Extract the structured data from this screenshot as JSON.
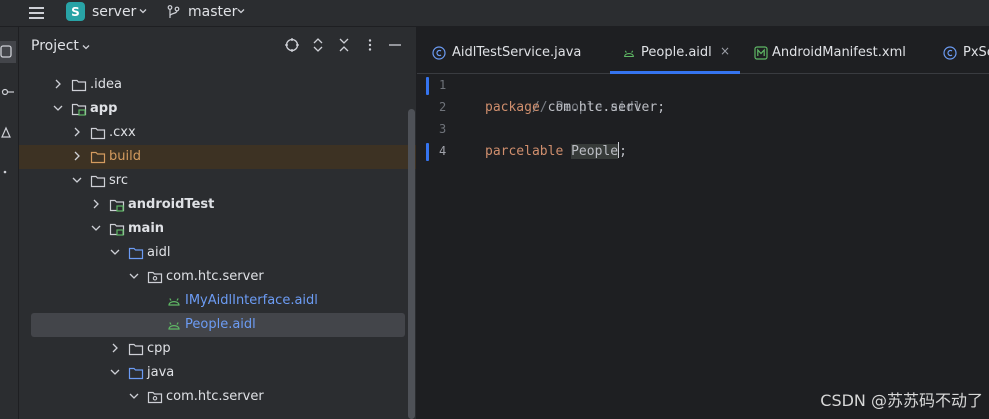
{
  "topbar": {
    "project_initial": "S",
    "project_name": "server",
    "branch_name": "master"
  },
  "project_panel": {
    "title": "Project",
    "tree": [
      {
        "label": ".idea",
        "type": "folder",
        "expanded": false
      },
      {
        "label": "app",
        "type": "module",
        "expanded": true
      },
      {
        "label": ".cxx",
        "type": "folder",
        "expanded": false
      },
      {
        "label": "build",
        "type": "folder-excluded",
        "expanded": false
      },
      {
        "label": "src",
        "type": "folder",
        "expanded": true
      },
      {
        "label": "androidTest",
        "type": "source-root",
        "expanded": false
      },
      {
        "label": "main",
        "type": "source-root",
        "expanded": true
      },
      {
        "label": "aidl",
        "type": "folder-blue",
        "expanded": true
      },
      {
        "label": "com.htc.server",
        "type": "package",
        "expanded": true
      },
      {
        "label": "IMyAidlInterface.aidl",
        "type": "aidl-file"
      },
      {
        "label": "People.aidl",
        "type": "aidl-file",
        "selected": true
      },
      {
        "label": "cpp",
        "type": "folder",
        "expanded": false
      },
      {
        "label": "java",
        "type": "folder-blue",
        "expanded": true
      },
      {
        "label": "com.htc.server",
        "type": "package",
        "expanded": true
      }
    ]
  },
  "editor": {
    "tabs": [
      {
        "label": "AidlTestService.java",
        "icon": "class-icon",
        "active": false
      },
      {
        "label": "People.aidl",
        "icon": "android-icon",
        "active": true,
        "close": "×"
      },
      {
        "label": "AndroidManifest.xml",
        "icon": "manifest-icon",
        "active": false
      },
      {
        "label": "PxSe",
        "icon": "class-icon",
        "active": false
      }
    ],
    "line_numbers": [
      "1",
      "2",
      "3",
      "4"
    ],
    "lines": {
      "l1": "// People.aidl",
      "l2_kw": "package",
      "l2_rest": " com.htc.server;",
      "l4_kw": "parcelable",
      "l4_sp": " ",
      "l4_ident": "People",
      "l4_end": ";"
    }
  },
  "colors": {
    "accent": "#3574f0",
    "keyword": "#cf8e6d",
    "comment": "#7a7e85",
    "aidl_file": "#6c9cf4",
    "excluded": "#d49b5f"
  },
  "watermark": "CSDN @苏苏码不动了"
}
